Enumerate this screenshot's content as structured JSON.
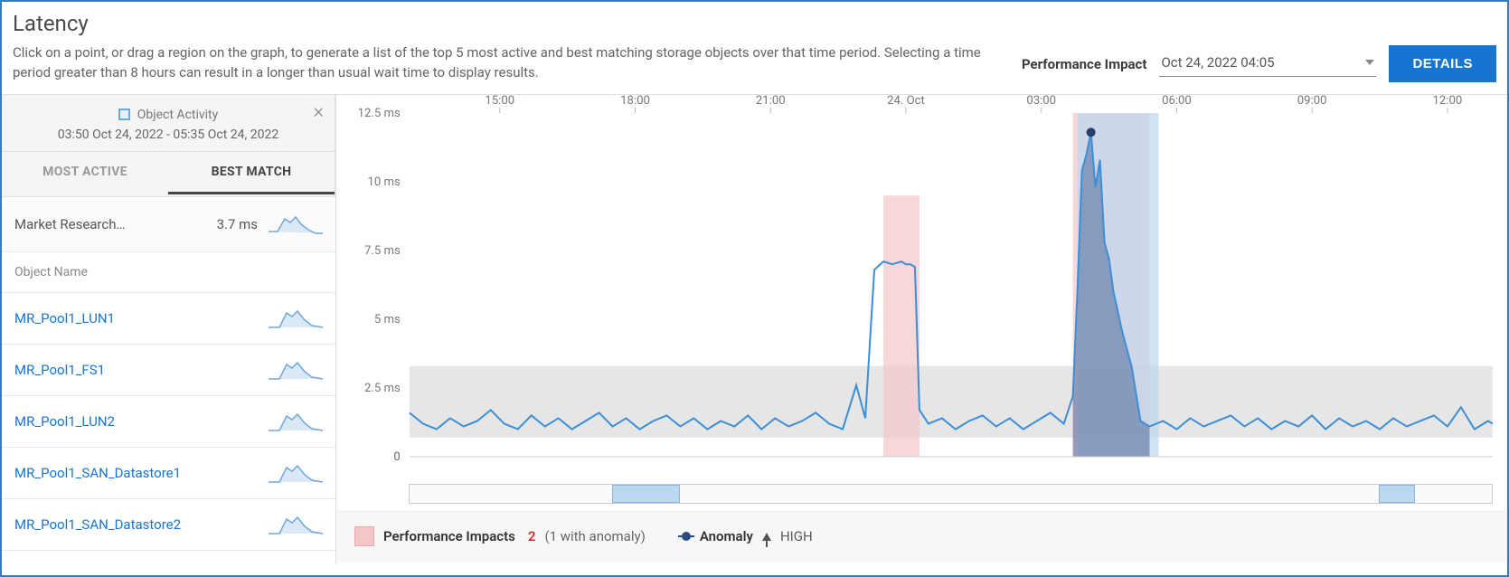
{
  "title": "Latency",
  "description": "Click on a point, or drag a region on the graph, to generate a list of the top 5 most active and best matching storage objects over that time period. Selecting a time period greater than 8 hours can result in a longer than usual wait time to display results.",
  "performance_impact": {
    "label": "Performance Impact",
    "timestamp": "Oct 24, 2022 04:05",
    "details_label": "DETAILS"
  },
  "sidebar": {
    "object_activity_label": "Object Activity",
    "time_range": "03:50 Oct 24, 2022  -  05:35 Oct 24, 2022",
    "tabs": {
      "most_active": "MOST ACTIVE",
      "best_match": "BEST MATCH"
    },
    "summary": {
      "name": "Market Research…",
      "value": "3.7 ms"
    },
    "object_name_header": "Object Name",
    "items": [
      {
        "label": "MR_Pool1_LUN1"
      },
      {
        "label": "MR_Pool1_FS1"
      },
      {
        "label": "MR_Pool1_LUN2"
      },
      {
        "label": "MR_Pool1_SAN_Datastore1"
      },
      {
        "label": "MR_Pool1_SAN_Datastore2"
      }
    ]
  },
  "legend": {
    "performance_impacts_label": "Performance Impacts",
    "performance_impacts_count": "2",
    "performance_impacts_sub": "(1 with anomaly)",
    "anomaly_label": "Anomaly",
    "anomaly_level": "HIGH"
  },
  "chart_data": {
    "type": "line",
    "title": "Latency",
    "xlabel": "",
    "ylabel": "",
    "y_unit": "ms",
    "ylim": [
      0,
      12.5
    ],
    "y_ticks": [
      0,
      2.5,
      5,
      7.5,
      10,
      12.5
    ],
    "x_ticks": [
      "15:00",
      "18:00",
      "21:00",
      "24. Oct",
      "03:00",
      "06:00",
      "09:00",
      "12:00"
    ],
    "x_range_hours": [
      13,
      37
    ],
    "baseline_band": {
      "low": 0.7,
      "high": 3.3
    },
    "baseline_band_color": "#e6e6e6",
    "anomaly_peak": {
      "time_h": 28.1,
      "value": 11.8
    },
    "highlight_bands": [
      {
        "label": "impact-1",
        "start_h": 23.5,
        "end_h": 24.3,
        "color": "#f4c6c9"
      },
      {
        "label": "impact-2",
        "start_h": 27.7,
        "end_h": 29.4,
        "color": "#f4c6c9"
      },
      {
        "label": "selection",
        "start_h": 27.8,
        "end_h": 29.6,
        "color": "#bcd7f0"
      }
    ],
    "series": [
      {
        "name": "Latency",
        "color": "#3d8fd6",
        "x": [
          13,
          13.3,
          13.6,
          13.9,
          14.2,
          14.5,
          14.8,
          15.1,
          15.4,
          15.7,
          16,
          16.3,
          16.6,
          16.9,
          17.2,
          17.5,
          17.8,
          18.1,
          18.4,
          18.7,
          19,
          19.3,
          19.6,
          19.9,
          20.2,
          20.5,
          20.8,
          21.1,
          21.4,
          21.7,
          22,
          22.3,
          22.6,
          22.9,
          23.1,
          23.3,
          23.5,
          23.7,
          23.9,
          24.0,
          24.1,
          24.2,
          24.3,
          24.5,
          24.8,
          25.1,
          25.4,
          25.7,
          26,
          26.3,
          26.6,
          26.9,
          27.2,
          27.5,
          27.7,
          27.8,
          27.9,
          28.0,
          28.1,
          28.2,
          28.3,
          28.4,
          28.5,
          28.6,
          28.8,
          29.0,
          29.2,
          29.4,
          29.7,
          30,
          30.3,
          30.6,
          30.9,
          31.2,
          31.5,
          31.8,
          32.1,
          32.4,
          32.7,
          33,
          33.3,
          33.6,
          33.9,
          34.2,
          34.5,
          34.8,
          35.1,
          35.4,
          35.7,
          36,
          36.3,
          36.6,
          36.9,
          37
        ],
        "y": [
          1.6,
          1.2,
          1.0,
          1.4,
          1.1,
          1.3,
          1.7,
          1.2,
          1.0,
          1.5,
          1.1,
          1.4,
          1.0,
          1.3,
          1.6,
          1.1,
          1.4,
          1.0,
          1.3,
          1.5,
          1.1,
          1.4,
          1.0,
          1.3,
          1.1,
          1.5,
          1.0,
          1.4,
          1.1,
          1.3,
          1.6,
          1.2,
          1.0,
          2.6,
          1.4,
          6.8,
          7.1,
          7.0,
          7.1,
          7.0,
          7.0,
          6.9,
          1.7,
          1.2,
          1.4,
          1.0,
          1.3,
          1.5,
          1.1,
          1.4,
          1.0,
          1.3,
          1.6,
          1.2,
          2.2,
          6.0,
          10.4,
          11.0,
          11.8,
          9.8,
          10.8,
          7.8,
          7.2,
          6.0,
          4.5,
          3.3,
          1.3,
          1.1,
          1.3,
          1.0,
          1.4,
          1.1,
          1.3,
          1.5,
          1.1,
          1.4,
          1.0,
          1.3,
          1.1,
          1.5,
          1.0,
          1.4,
          1.1,
          1.3,
          1.0,
          1.4,
          1.1,
          1.3,
          1.5,
          1.1,
          1.8,
          1.0,
          1.3,
          1.2
        ]
      }
    ],
    "scrub_segments": [
      {
        "start_h": 17.5,
        "end_h": 19.0
      },
      {
        "start_h": 34.5,
        "end_h": 35.3
      }
    ]
  }
}
